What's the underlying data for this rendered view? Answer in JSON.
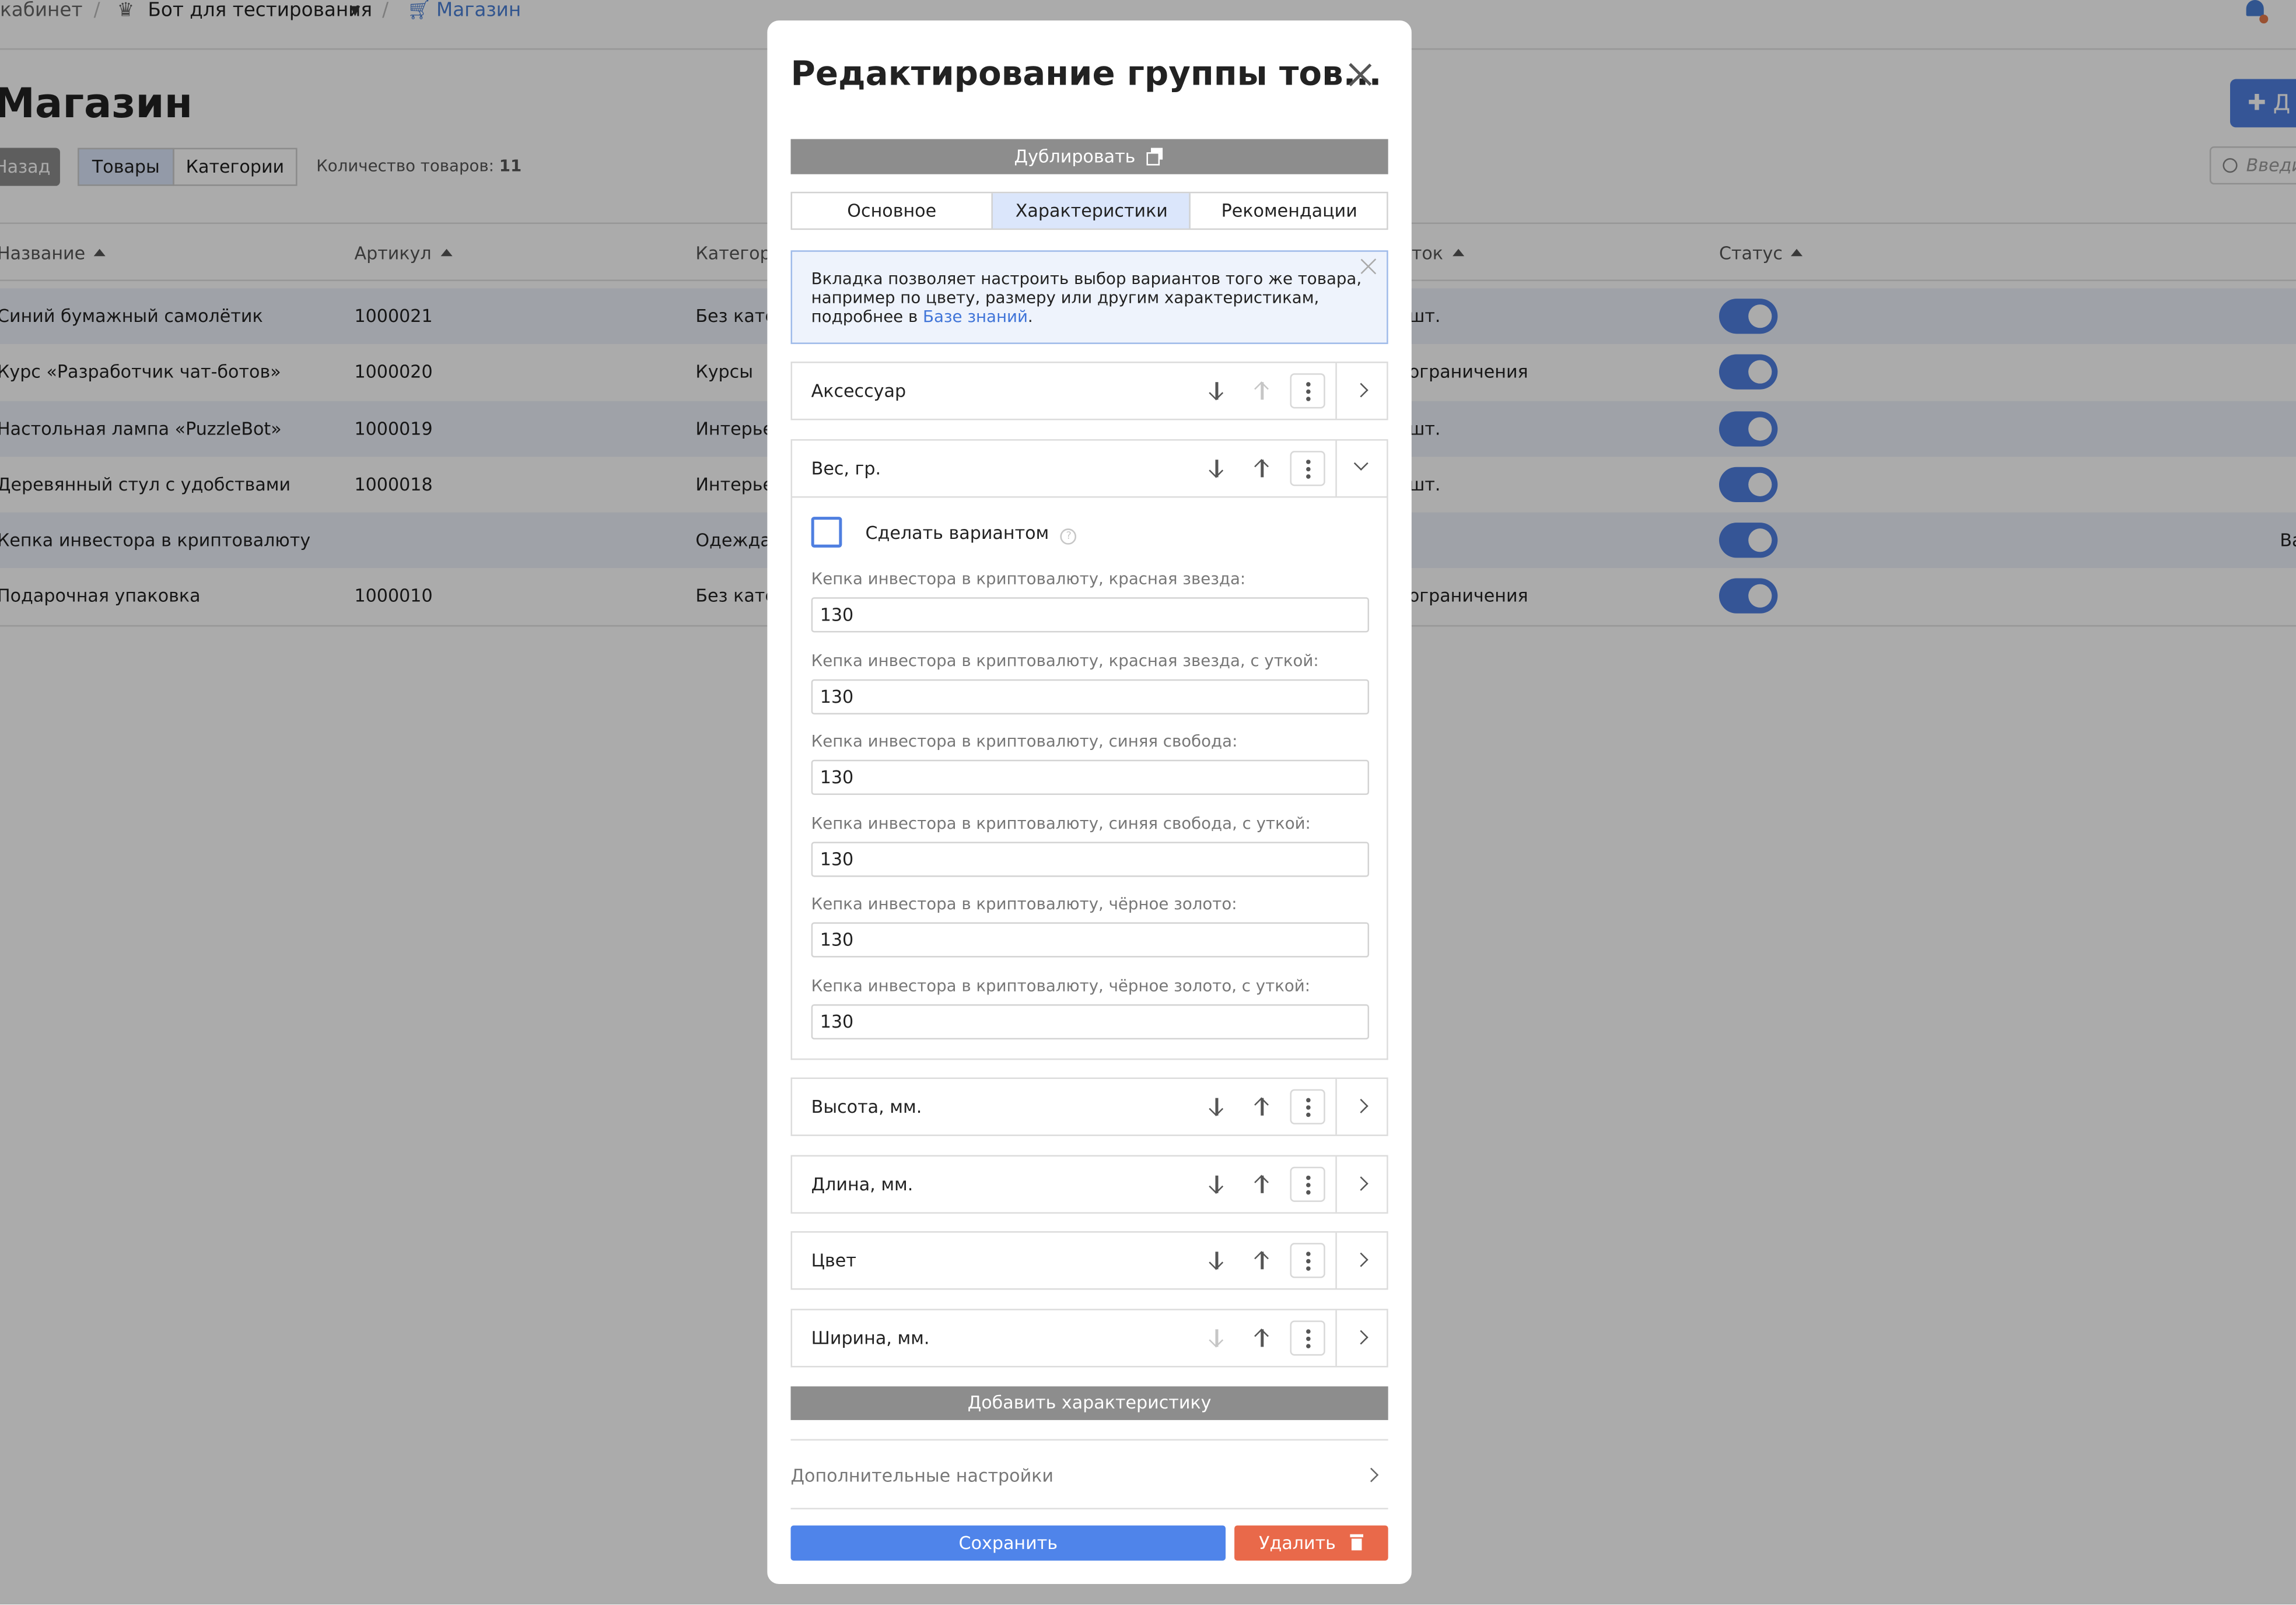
{
  "breadcrumb": {
    "cabinet": "кабинет",
    "bot": "Бот для тестирования",
    "shop": "Магазин"
  },
  "page": {
    "title": "Магазин",
    "add_button": "Д",
    "back_button": "Назад",
    "view_tabs": [
      "Товары",
      "Категории"
    ],
    "count_label": "Количество товаров:",
    "count_value": "11",
    "search_placeholder": "Введи"
  },
  "table": {
    "columns": [
      "Название",
      "Артикул",
      "Категори",
      "ток",
      "Статус"
    ],
    "rows": [
      {
        "name": "Синий бумажный самолётик",
        "sku": "1000021",
        "category": "Без катег",
        "stock": "шт."
      },
      {
        "name": "Курс «Разработчик чат-ботов»",
        "sku": "1000020",
        "category": "Курсы",
        "stock": "ограничения"
      },
      {
        "name": "Настольная лампа «PuzzleBot»",
        "sku": "1000019",
        "category": "Интерьер",
        "stock": "шт."
      },
      {
        "name": "Деревянный стул с удобствами",
        "sku": "1000018",
        "category": "Интерьер",
        "stock": "шт."
      },
      {
        "name": "Кепка инвестора в криптовалюту",
        "sku": "",
        "category": "Одежда",
        "stock": ""
      },
      {
        "name": "Подарочная упаковка",
        "sku": "1000010",
        "category": "Без катег",
        "stock": "ограничения"
      }
    ],
    "row5_extra": "Ва"
  },
  "modal": {
    "title": "Редактирование группы тов...",
    "duplicate_button": "Дублировать",
    "tabs": [
      "Основное",
      "Характеристики",
      "Рекомендации"
    ],
    "info": {
      "text": "Вкладка позволяет настроить выбор вариантов того же товара, например по цвету, размеру или другим характеристикам, подробнее в ",
      "link": "Базе знаний",
      "tail": "."
    },
    "characteristics": [
      {
        "name": "Аксессуар"
      },
      {
        "name": "Вес, гр."
      },
      {
        "name": "Высота, мм."
      },
      {
        "name": "Длина, мм."
      },
      {
        "name": "Цвет"
      },
      {
        "name": "Ширина, мм."
      }
    ],
    "variant_checkbox_label": "Сделать вариантом",
    "help_glyph": "?",
    "fields": [
      {
        "label": "Кепка инвестора  в криптовалюту, красная звезда:",
        "value": "130"
      },
      {
        "label": "Кепка инвестора  в криптовалюту, красная звезда, с уткой:",
        "value": "130"
      },
      {
        "label": "Кепка инвестора  в криптовалюту, синяя свобода:",
        "value": "130"
      },
      {
        "label": "Кепка инвестора  в криптовалюту, синяя свобода, с уткой:",
        "value": "130"
      },
      {
        "label": "Кепка инвестора  в криптовалюту, чёрное золото:",
        "value": "130"
      },
      {
        "label": "Кепка инвестора  в криптовалюту, чёрное золото, с уткой:",
        "value": "130"
      }
    ],
    "add_characteristic_button": "Добавить характеристику",
    "advanced_settings": "Дополнительные настройки",
    "save_button": "Сохранить",
    "delete_button": "Удалить"
  },
  "colors": {
    "accent": "#4f7fe0",
    "danger": "#e9694a",
    "muted_button": "#8d8d8d"
  }
}
